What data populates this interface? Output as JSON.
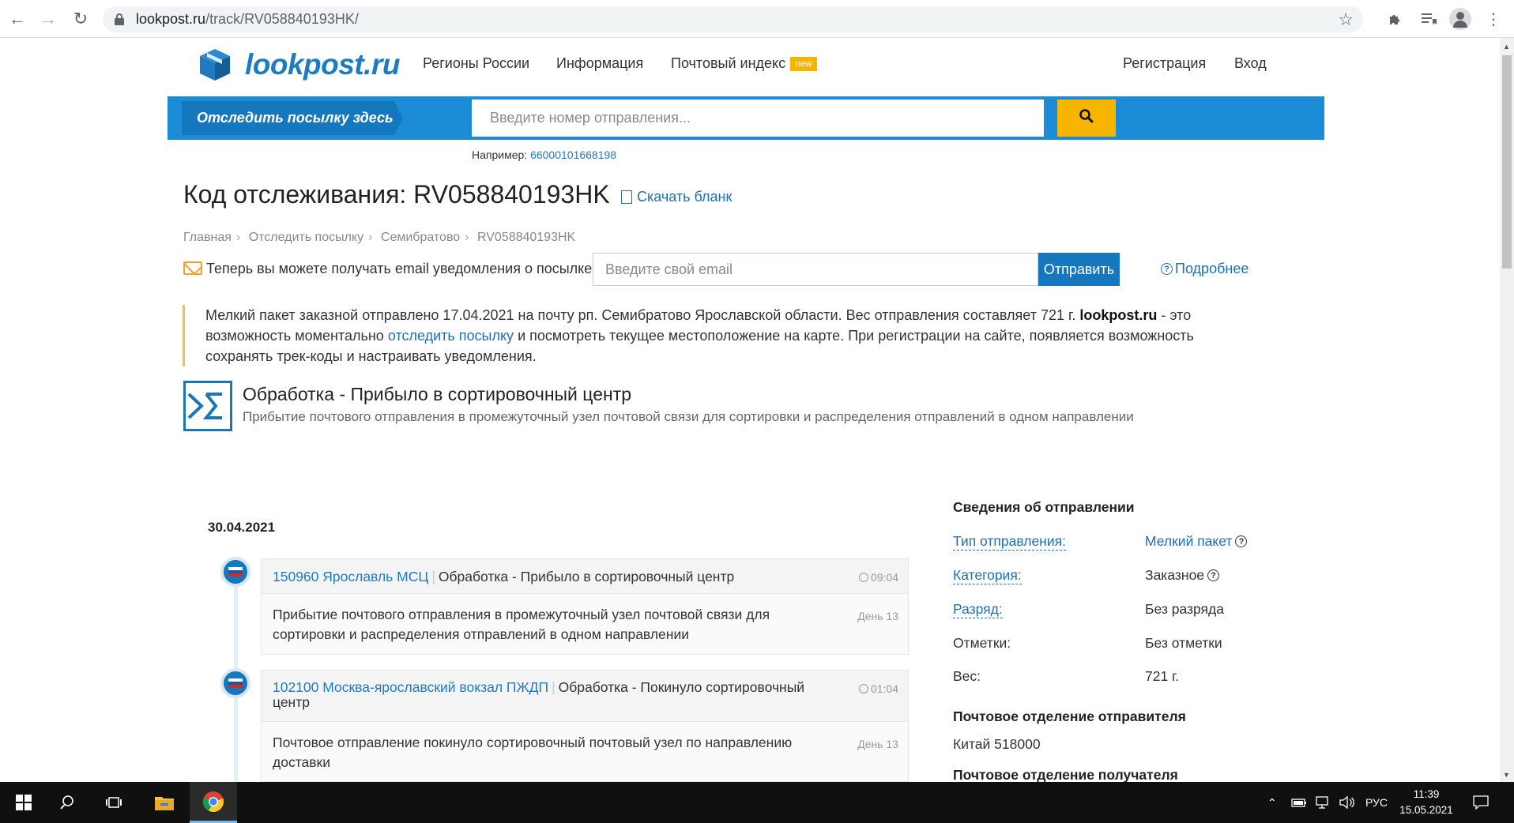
{
  "browser": {
    "url_host": "lookpost.ru",
    "url_path": "/track/RV058840193HK/"
  },
  "site": {
    "logo_text": "lookpost.ru",
    "nav": {
      "regions": "Регионы России",
      "info": "Информация",
      "postal_index": "Почтовый индекс",
      "new_badge": "new",
      "register": "Регистрация",
      "login": "Вход"
    },
    "colors": {
      "brand_blue": "#1c8cd6",
      "dark_blue": "#1577bd",
      "accent_yellow": "#f7b500"
    }
  },
  "search": {
    "tag_label": "Отследить посылку здесь",
    "placeholder": "Введите номер отправления...",
    "example_label": "Например:",
    "example_value": "66000101668198"
  },
  "title": {
    "heading": "Код отслеживания: RV058840193HK",
    "download_label": "Скачать бланк"
  },
  "breadcrumb": [
    "Главная",
    "Отследить посылку",
    "Семибратово",
    "RV058840193HK"
  ],
  "email_notify": {
    "text": "Теперь вы можете получать email уведомления о посылке",
    "placeholder": "Введите свой email",
    "send_label": "Отправить",
    "more_label": "Подробнее"
  },
  "info": {
    "text1": "Мелкий пакет заказной отправлено 17.04.2021 на почту рп. Семибратово Ярославской области. Вес отправления составляет 721 г. ",
    "brand": "lookpost.ru",
    "text2": " - это возможность моментально ",
    "link": "отследить посылку",
    "text3": " и посмотреть текущее местоположение на карте. При регистрации на сайте, появляется возможность сохранять трек-коды и настраивать уведомления."
  },
  "status": {
    "title": "Обработка - Прибыло в сортировочный центр",
    "description": "Прибытие почтового отправления в промежуточный узел почтовой связи для сортировки и распределения отправлений в одном направлении"
  },
  "timeline": {
    "date": "30.04.2021",
    "events": [
      {
        "office": "150960 Ярославль МСЦ",
        "operation": "Обработка - Прибыло в сортировочный центр",
        "time": "09:04",
        "description": "Прибытие почтового отправления в промежуточный узел почтовой связи для сортировки и распределения отправлений в одном направлении",
        "day": "День 13"
      },
      {
        "office": "102100 Москва-ярославский вокзал ПЖДП",
        "operation": "Обработка - Покинуло сортировочный центр",
        "time": "01:04",
        "description": "Почтовое отправление покинуло сортировочный почтовый узел по направлению доставки",
        "day": "День 13"
      }
    ]
  },
  "details": {
    "heading": "Сведения об отправлении",
    "rows": [
      {
        "key": "Тип отправления:",
        "value": "Мелкий пакет"
      },
      {
        "key": "Категория:",
        "value": "Заказное"
      },
      {
        "key": "Разряд:",
        "value": "Без разряда"
      },
      {
        "key": "Отметки:",
        "value": "Без отметки"
      },
      {
        "key": "Вес:",
        "value": "721 г."
      }
    ],
    "sender_heading": "Почтовое отделение отправителя",
    "sender_value": "Китай 518000",
    "recipient_heading": "Почтовое отделение получателя"
  },
  "taskbar": {
    "language": "РУС",
    "time": "11:39",
    "date": "15.05.2021"
  }
}
